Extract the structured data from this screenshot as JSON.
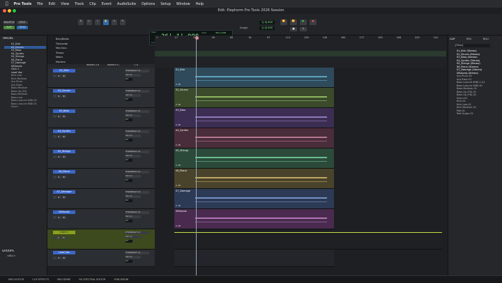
{
  "menubar": {
    "app": "Pro Tools",
    "items": [
      "File",
      "Edit",
      "View",
      "Track",
      "Clip",
      "Event",
      "AudioSuite",
      "Options",
      "Setup",
      "Window",
      "Help"
    ]
  },
  "window": {
    "title": "Edit: Elephorm Pro Tools 2026 Session"
  },
  "toolbar": {
    "shuffle": "SHUFFLE",
    "spot": "SPOT",
    "slip": "SLIP",
    "grid": "GRID",
    "counter_main": "36| 1| 000",
    "counter_label": "Main",
    "cursor_label": "Cursor",
    "start_label": "Start",
    "end_label": "End",
    "length_label": "Length",
    "start": "36| 1| 000",
    "end": "36| 1| 000",
    "length": "0| 0| 000",
    "cursor_val": "36| 3| 495",
    "nudge_label": "Nudge",
    "grid_value": "1| 0| 000",
    "nudge_value": "1| 0| 000"
  },
  "tracks_panel": {
    "header": "TRACKS",
    "items": [
      "01_Kick",
      "02_Drums",
      "03_Bass",
      "04_Synths",
      "05_Strings",
      "06_Piano",
      "07_Damage",
      "08Vocals",
      "Click 1",
      "Lead Vox",
      "Kick Low",
      "Kick Medium",
      "Arp Pluck",
      "Arp Riser",
      "Bass Medium",
      "Bass Up (FX)",
      "Bass Medium",
      "Bass Low",
      "Bass Low.cnt.MIDI.01",
      "Bass Low.cnt.MIDI.01",
      "Drum"
    ],
    "groups_header": "GROUPS",
    "groups_all": "<ALL>"
  },
  "ruler": {
    "labels": [
      "Bars|Beats",
      "Timecode",
      "Min:Secs",
      "Tempo",
      "Meter",
      "Markers"
    ],
    "bars": [
      "1",
      "17",
      "33",
      "49",
      "65",
      "81",
      "97",
      "113",
      "129",
      "145",
      "161",
      "177",
      "193",
      "209",
      "225",
      "241"
    ]
  },
  "tracks": [
    {
      "name": "01_Kick",
      "clip": "01_Kick",
      "color": "#2f4a5a",
      "wave": "#6ab6d8"
    },
    {
      "name": "02_Drums",
      "clip": "02_Drums",
      "color": "#3a4a2b",
      "wave": "#a6cf72"
    },
    {
      "name": "03_Bass",
      "clip": "03_Bass",
      "color": "#3c2e52",
      "wave": "#a58bd8"
    },
    {
      "name": "04_Synths",
      "clip": "04_Synths",
      "color": "#4a2d3a",
      "wave": "#d08aa8"
    },
    {
      "name": "05_Strings",
      "clip": "05_Strings",
      "color": "#2b4a3a",
      "wave": "#7cd8a6"
    },
    {
      "name": "06_Piano",
      "clip": "06_Piano",
      "color": "#4a432b",
      "wave": "#d8c070"
    },
    {
      "name": "07_Damage",
      "clip": "07_Damage",
      "color": "#2d3a55",
      "wave": "#86a6e0"
    },
    {
      "name": "08Vocals",
      "clip": "08Vocals",
      "color": "#4a2b4f",
      "wave": "#c888d0"
    },
    {
      "name": "Click 1",
      "clip": "",
      "color": "#2c3a1a",
      "wave": "#c0e040"
    },
    {
      "name": "Lead Vox",
      "clip": "",
      "color": "#23252a",
      "wave": "#888"
    }
  ],
  "inserts": {
    "ae": "INSERTS A-E",
    "fj": "INSERTS F-J",
    "io": "I / O",
    "input": "PrTstAbBeGrt 1/2",
    "output": "Out 1-2",
    "volume": "0.0",
    "gain": "0 dB"
  },
  "clips_panel": {
    "tabs": [
      "CLIP",
      "EPLI",
      "BOU"
    ],
    "filter": "[Filter]",
    "items": [
      "01_Kick (Stereo)",
      "02_Drums (Stereo)",
      "03_Bass (Stereo)",
      "04_Synths (Stereo)",
      "05_Strings (Stereo)",
      "06_Piano (Stereo)",
      "07_Damage (Stereo)",
      "08Vocals (Stereo)",
      "Arp Pluck-01",
      "Arp Riser-01",
      "Bass Low.cnt.MIDI-1-01",
      "Bass Low.cnt.MIDI-01",
      "Bass Medium-01",
      "Bass Up (FX)-01",
      "Bass Up (FX)-01",
      "Drum-01",
      "Kick-01",
      "Kick Low-01",
      "Kick Medium-01",
      "Pad-01",
      "Pad Organ-01"
    ]
  },
  "bottombar": {
    "items": [
      "MIDI EDITOR",
      "CLIP EFFECTS",
      "MELODYNE",
      "RX SPECTRAL EDITOR",
      "SYNCHRONI"
    ]
  }
}
